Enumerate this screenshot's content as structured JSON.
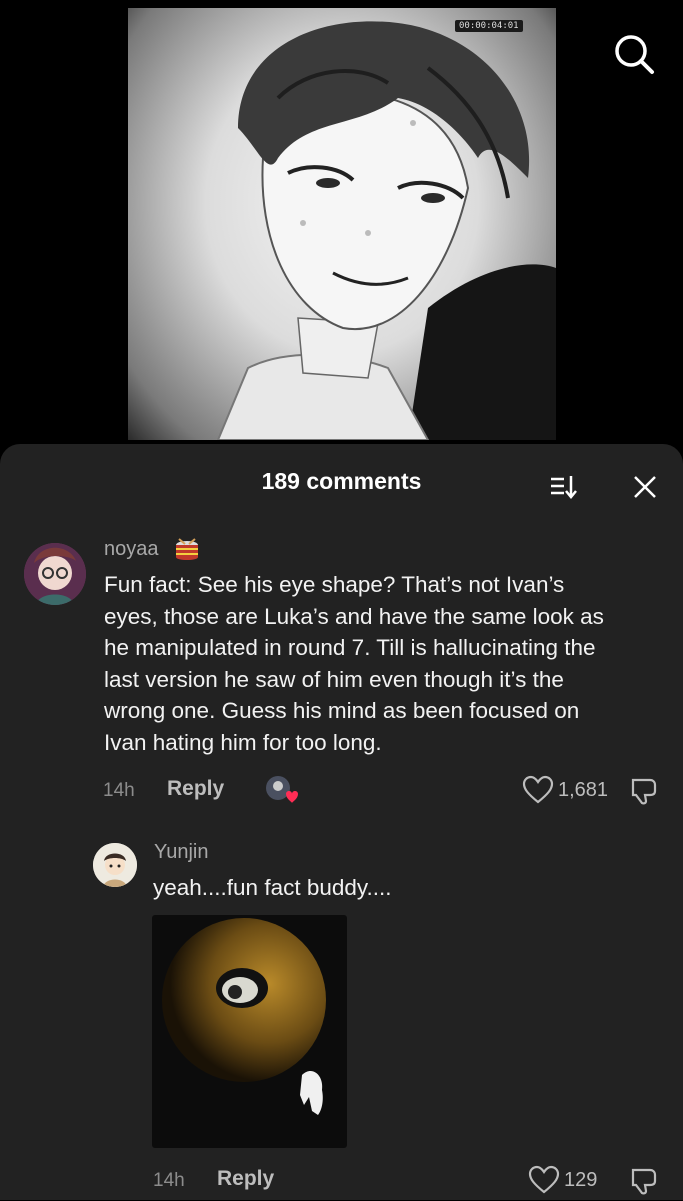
{
  "video": {
    "timestamp": "00:00:04:01"
  },
  "sheet": {
    "title": "189 comments"
  },
  "comments": [
    {
      "username": "noyaa",
      "text_lines": [
        "Fun fact: See his eye shape? That’s not Ivan’s",
        "eyes, those are Luka’s and have the same look as",
        "he manipulated in round 7. Till is hallucinating the",
        "last version he saw of him even though it’s the",
        "wrong one. Guess his mind as been focused on",
        "Ivan hating him for too long."
      ],
      "time": "14h",
      "reply_label": "Reply",
      "likes": "1,681"
    },
    {
      "username": "Yunjin",
      "text": "yeah....fun fact buddy....",
      "time": "14h",
      "reply_label": "Reply",
      "likes": "129"
    }
  ],
  "icons": {
    "search": "search-icon",
    "sort": "sort-icon",
    "close": "close-icon",
    "badge": "drum-emoji",
    "heart": "heart-outline-icon",
    "dislike": "dislike-icon",
    "creator_like": "creator-liked-avatar"
  },
  "colors": {
    "sheet_bg": "#222222",
    "muted_text": "#a8a8a8",
    "heart_red": "#ff2d55"
  }
}
